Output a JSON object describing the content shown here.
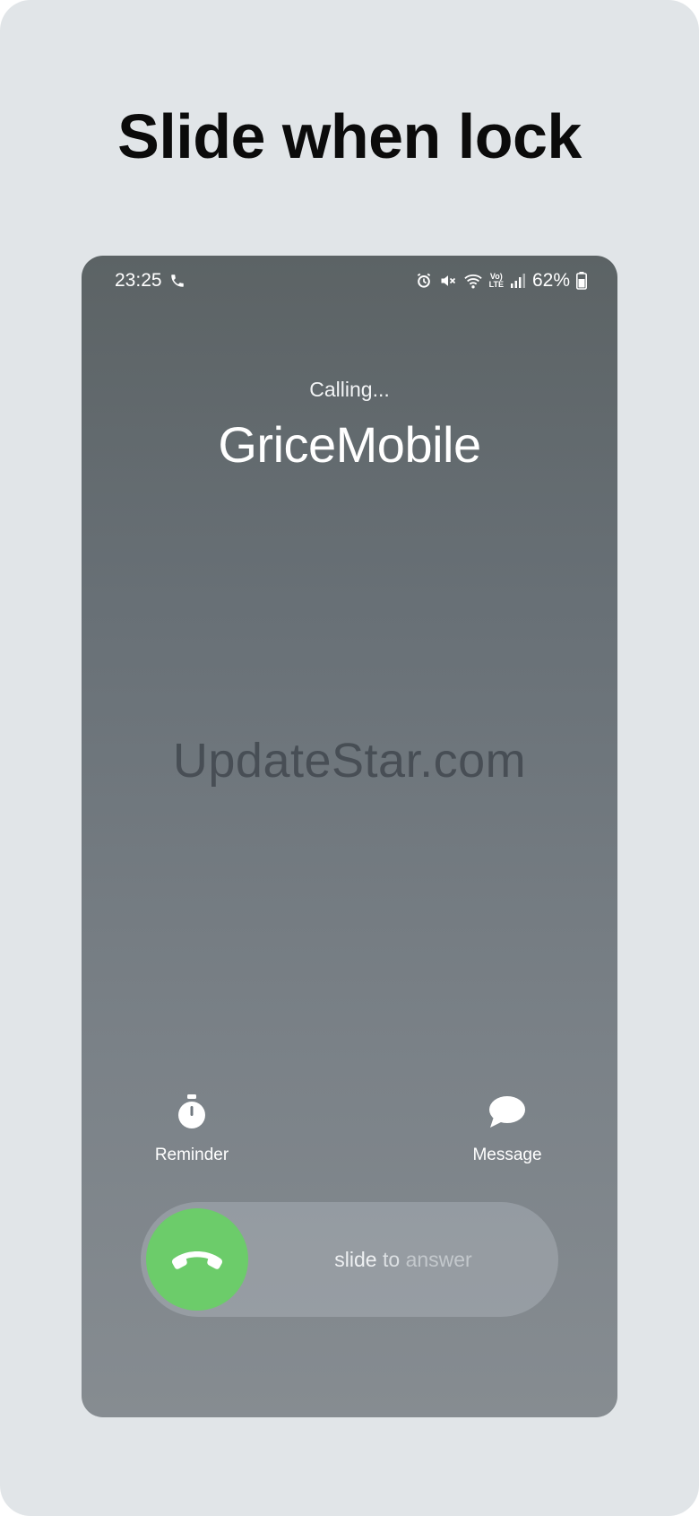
{
  "headline": "Slide when lock",
  "status_bar": {
    "time": "23:25",
    "battery": "62%",
    "network": [
      "Vo)",
      "LTE"
    ],
    "icons": [
      "phone-icon",
      "alarm-icon",
      "mute-icon",
      "wifi-icon",
      "volte-icon",
      "signal-icon",
      "battery-icon"
    ]
  },
  "call": {
    "status": "Calling...",
    "caller": "GriceMobile"
  },
  "watermark": "UpdateStar.com",
  "actions": {
    "reminder": "Reminder",
    "message": "Message"
  },
  "slider": {
    "words": [
      "slide",
      "to",
      "answer"
    ]
  },
  "colors": {
    "answer_green": "#6ccc6a",
    "background": "#e1e5e8"
  }
}
